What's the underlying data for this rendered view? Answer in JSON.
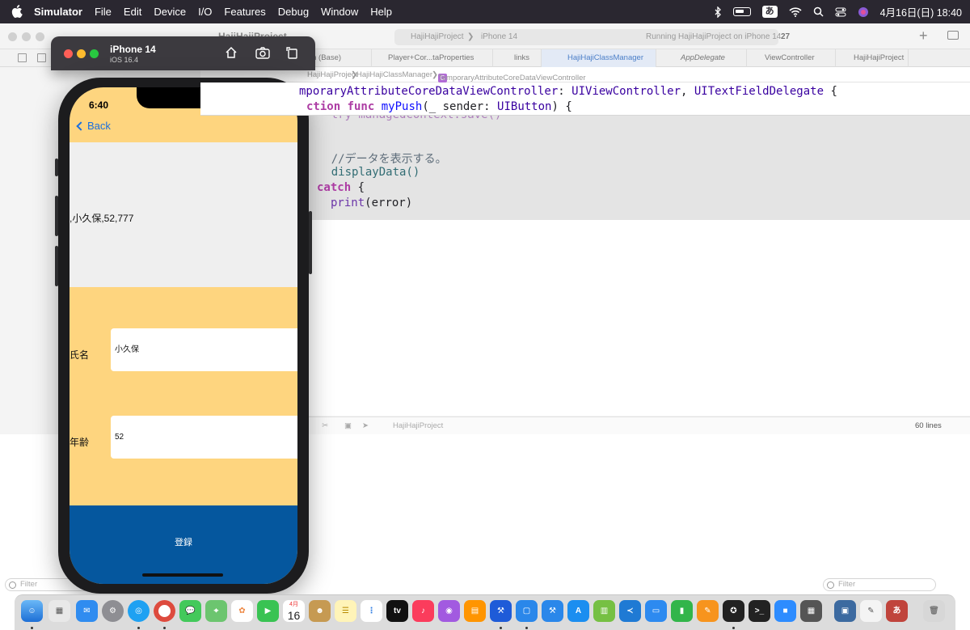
{
  "menubar": {
    "app_name": "Simulator",
    "items": [
      "File",
      "Edit",
      "Device",
      "I/O",
      "Features",
      "Debug",
      "Window",
      "Help"
    ],
    "ime": "あ",
    "datetime": "4月16日(日)  18:40"
  },
  "xcode": {
    "project_title": "HajiHajiProject",
    "scheme": "HajiHajiProject",
    "destination": "iPhone 14",
    "status": "Running HajiHajiProject on iPhone 14",
    "warnings_count": "27",
    "tabs": [
      "in (Base)",
      "Player+Cor...taProperties",
      "links",
      "HajiHajiClassManager",
      "AppDelegate",
      "ViewController",
      "HajiHajiProject"
    ],
    "active_tab_index": 3,
    "jumpbar": [
      "HajiHajiProject",
      "HajiHajiClassManager",
      "TemporaryAttributeCoreDataViewController"
    ],
    "class_badge": "C",
    "sticky_line1": {
      "a": "mporaryAttributeCoreDataViewController",
      "b": ": ",
      "c": "UIViewController",
      "d": ", ",
      "e": "UITextFieldDelegate",
      "f": " {"
    },
    "sticky_line2": {
      "a": "ction ",
      "b": "func ",
      "c": "myPush",
      "d": "(_ sender: ",
      "e": "UIButton",
      "f": ") {"
    },
    "code_partial": "    try managedContext.save()",
    "code_comment": "    //データを表示する。",
    "code_call": "    displayData()",
    "code_catch_kw": "catch",
    "code_catch_rest": " {",
    "code_print_fn": "print",
    "code_print_rest": "(error)",
    "debug_target": "HajiHajiProject",
    "line_count": "60 lines",
    "filter_placeholder": "Filter"
  },
  "simulator": {
    "device_name": "iPhone 14",
    "os_version": "iOS 16.4"
  },
  "phone": {
    "time": "6:40",
    "back_label": "Back",
    "display_text": ",小久保,52,777",
    "name_label": "氏名",
    "name_value": "小久保",
    "age_label": "年齢",
    "age_value": "52",
    "register_label": "登録"
  },
  "dock": {
    "calendar_month": "4月",
    "calendar_day": "16",
    "tv_label": "tv"
  },
  "colors": {
    "menubar": "#2a2730",
    "phone_background": "#fed57f",
    "display_area": "#efefef",
    "register_button": "#05579e",
    "back_link": "#1a6fe0"
  }
}
